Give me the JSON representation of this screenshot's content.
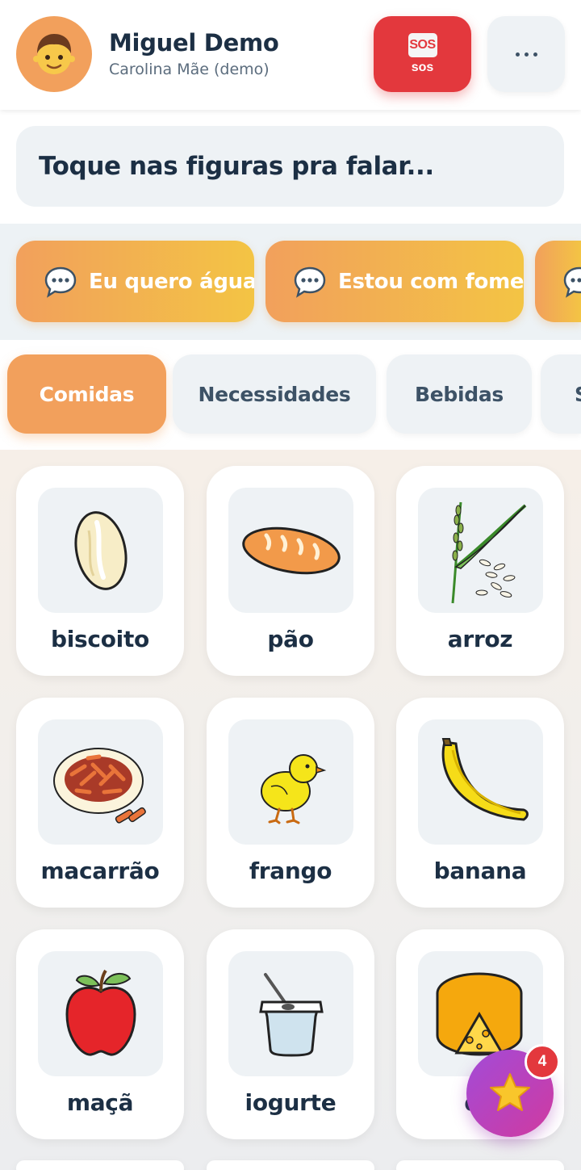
{
  "header": {
    "user_name": "Miguel Demo",
    "user_subtitle": "Carolina Mãe (demo)",
    "avatar_icon": "boy-face-icon",
    "sos_icon_text": "SOS",
    "sos_label": "sos",
    "more_icon": "more-dots-icon"
  },
  "sentence": {
    "placeholder": "Toque nas figuras pra falar..."
  },
  "phrases": [
    {
      "label": "Eu quero água",
      "icon": "speech-bubble-icon"
    },
    {
      "label": "Estou com fome",
      "icon": "speech-bubble-icon"
    },
    {
      "label": "",
      "icon": "speech-bubble-icon"
    }
  ],
  "categories": [
    {
      "label": "Comidas",
      "active": true
    },
    {
      "label": "Necessidades",
      "active": false
    },
    {
      "label": "Bebidas",
      "active": false
    },
    {
      "label": "S",
      "active": false
    }
  ],
  "cards": [
    {
      "label": "biscoito",
      "icon": "cookie-icon"
    },
    {
      "label": "pão",
      "icon": "bread-icon"
    },
    {
      "label": "arroz",
      "icon": "rice-icon"
    },
    {
      "label": "macarrão",
      "icon": "pasta-icon"
    },
    {
      "label": "frango",
      "icon": "chick-icon"
    },
    {
      "label": "banana",
      "icon": "banana-icon"
    },
    {
      "label": "maçã",
      "icon": "apple-icon"
    },
    {
      "label": "iogurte",
      "icon": "yogurt-icon"
    },
    {
      "label": "qu",
      "icon": "cheese-icon"
    }
  ],
  "favorites": {
    "icon": "star-icon",
    "badge_count": "4"
  },
  "colors": {
    "primary_orange": "#f2a05c",
    "sos_red": "#e3383d",
    "text_dark": "#1c2f44",
    "tile_bg": "#eef2f5",
    "fab_purple": "#a24bd8"
  }
}
